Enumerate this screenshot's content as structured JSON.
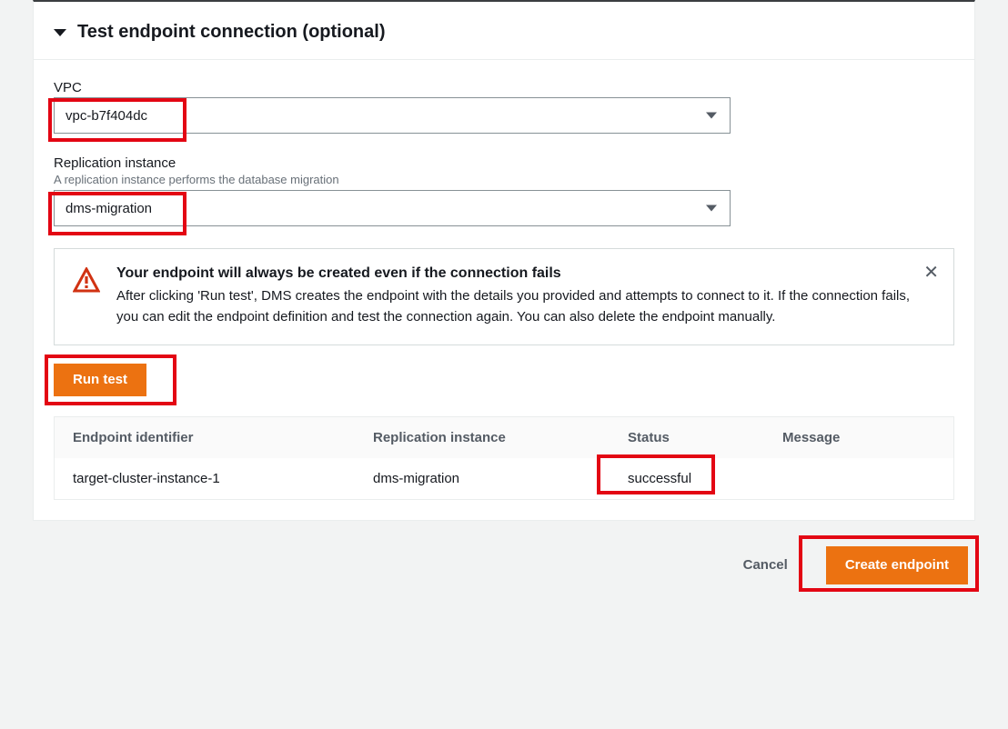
{
  "section": {
    "title": "Test endpoint connection (optional)"
  },
  "vpc": {
    "label": "VPC",
    "value": "vpc-b7f404dc"
  },
  "replication": {
    "label": "Replication instance",
    "desc": "A replication instance performs the database migration",
    "value": "dms-migration"
  },
  "alert": {
    "title": "Your endpoint will always be created even if the connection fails",
    "body": "After clicking 'Run test', DMS creates the endpoint with the details you provided and attempts to connect to it. If the connection fails, you can edit the endpoint definition and test the connection again. You can also delete the endpoint manually."
  },
  "buttons": {
    "run_test": "Run test",
    "cancel": "Cancel",
    "create": "Create endpoint"
  },
  "table": {
    "headers": {
      "endpoint": "Endpoint identifier",
      "replication": "Replication instance",
      "status": "Status",
      "message": "Message"
    },
    "row": {
      "endpoint": "target-cluster-instance-1",
      "replication": "dms-migration",
      "status": "successful",
      "message": ""
    }
  }
}
